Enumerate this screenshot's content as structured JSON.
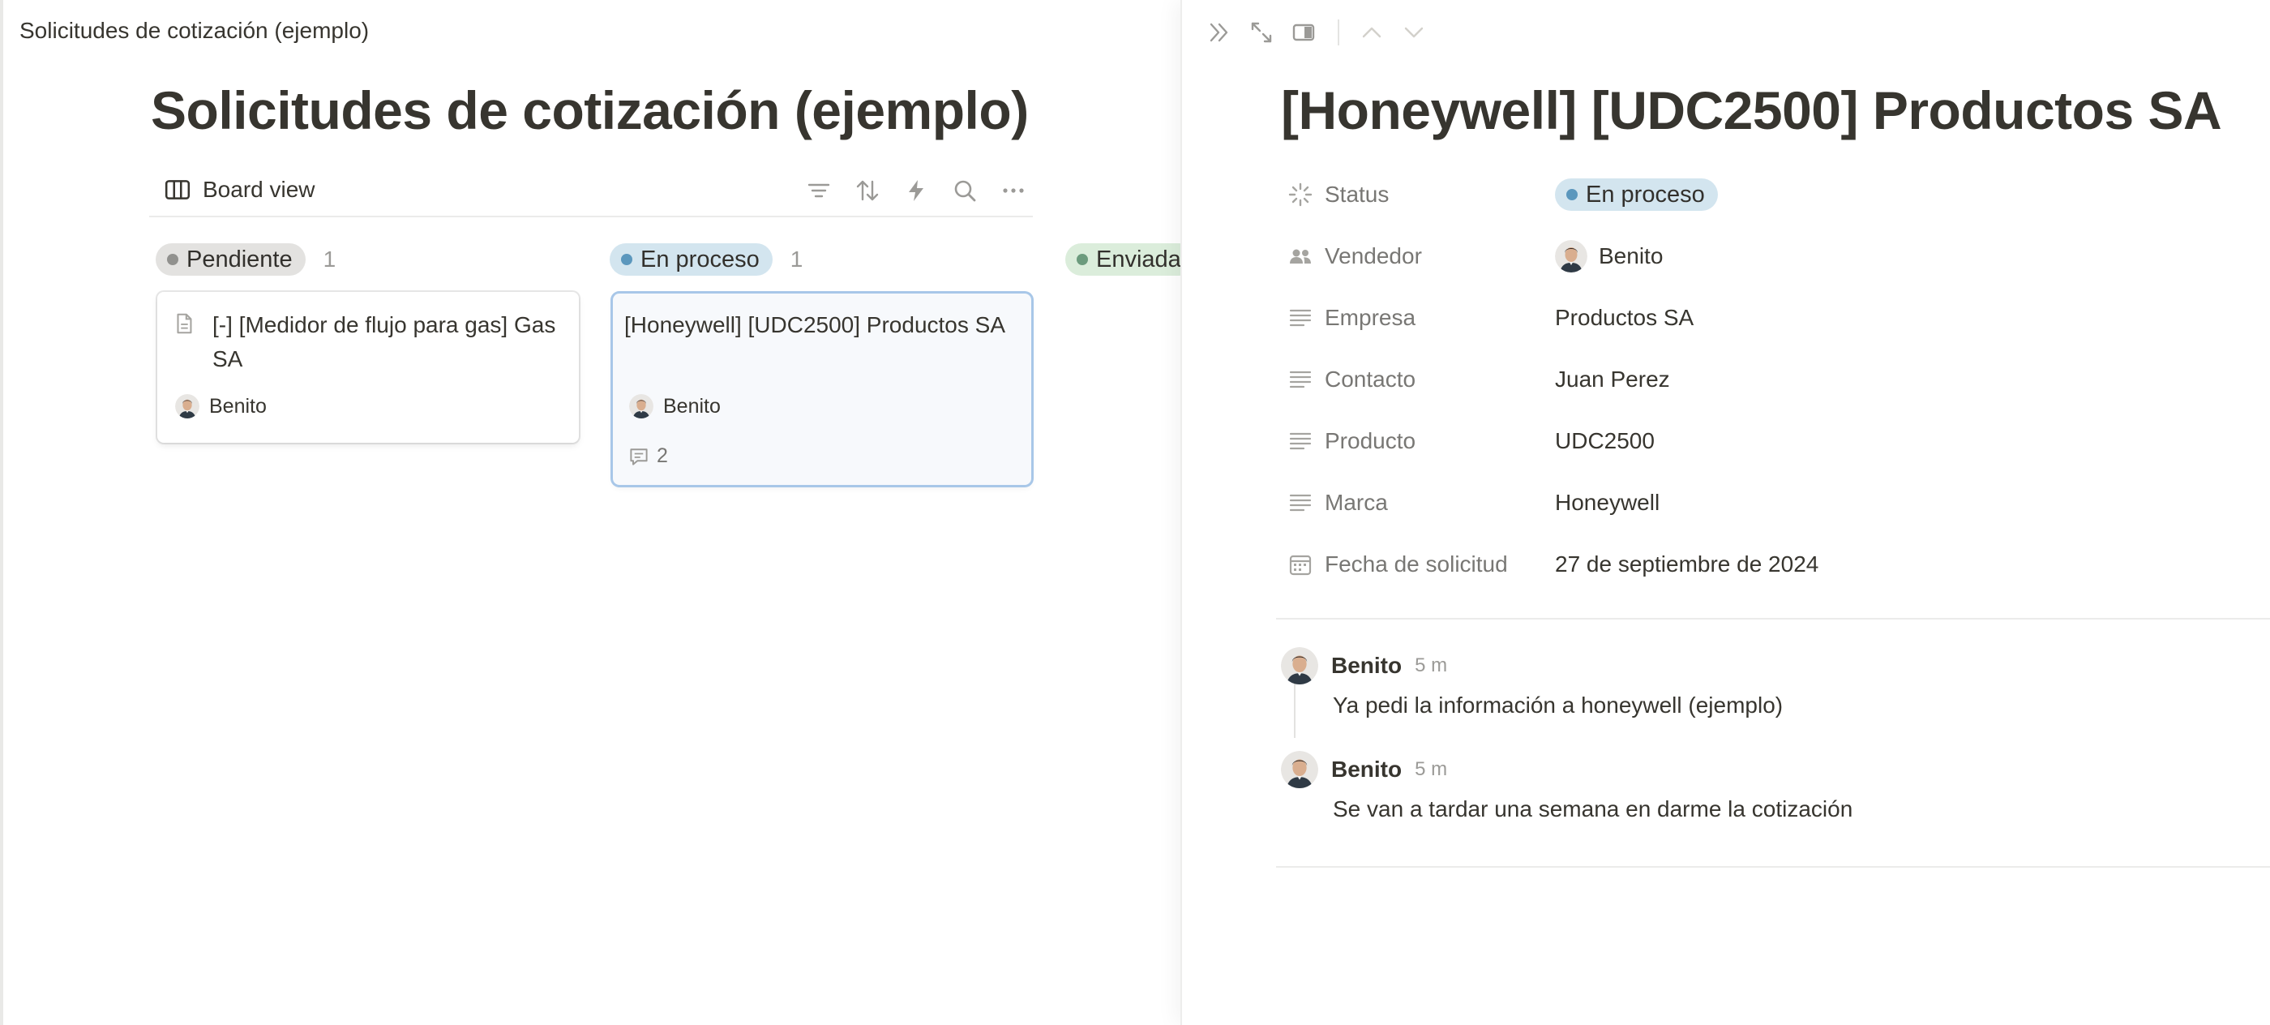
{
  "window": {
    "title": "Solicitudes de cotización (ejemplo)"
  },
  "database": {
    "title": "Solicitudes de cotización (ejemplo)",
    "view": {
      "label": "Board view",
      "icon": "board-view-icon"
    },
    "tools": [
      "filter-icon",
      "sort-icon",
      "automation-bolt-icon",
      "search-icon",
      "more-icon"
    ]
  },
  "board": {
    "groups": [
      {
        "label": "Pendiente",
        "count": "1",
        "color": "#91918e",
        "cards": [
          {
            "title": "[-] [Medidor de flujo para gas] Gas SA",
            "person": "Benito",
            "icon": "page-icon"
          }
        ]
      },
      {
        "label": "En proceso",
        "count": "1",
        "color": "#5b97bd",
        "cards": [
          {
            "title": "[Honeywell] [UDC2500] Productos SA",
            "person": "Benito",
            "comments": "2",
            "selected": true
          }
        ]
      },
      {
        "label": "Enviada",
        "color": "#6c9b7d"
      }
    ]
  },
  "record": {
    "toolbar": [
      "close-panel-icon",
      "expand-icon",
      "side-peek-icon",
      "chevron-up-icon",
      "chevron-down-icon"
    ],
    "title": "[Honeywell] [UDC2500] Productos SA",
    "properties": [
      {
        "name": "Status",
        "icon": "status-icon",
        "value": "En proceso",
        "kind": "status"
      },
      {
        "name": "Vendedor",
        "icon": "people-icon",
        "value": "Benito",
        "kind": "person"
      },
      {
        "name": "Empresa",
        "icon": "text-icon",
        "value": "Productos SA"
      },
      {
        "name": "Contacto",
        "icon": "text-icon",
        "value": "Juan Perez"
      },
      {
        "name": "Producto",
        "icon": "text-icon",
        "value": "UDC2500"
      },
      {
        "name": "Marca",
        "icon": "text-icon",
        "value": "Honeywell"
      },
      {
        "name": "Fecha de solicitud",
        "icon": "calendar-icon",
        "value": "27 de septiembre de 2024"
      }
    ],
    "comments": [
      {
        "author": "Benito",
        "time": "5 m",
        "text": "Ya pedi la información a honeywell (ejemplo)"
      },
      {
        "author": "Benito",
        "time": "5 m",
        "text": "Se van a tardar una semana en darme la cotización"
      }
    ]
  },
  "colors": {
    "status_blue_bg": "#d3e5ef",
    "status_blue_dot": "#5b97bd",
    "selected_border": "#a8c7e8"
  }
}
